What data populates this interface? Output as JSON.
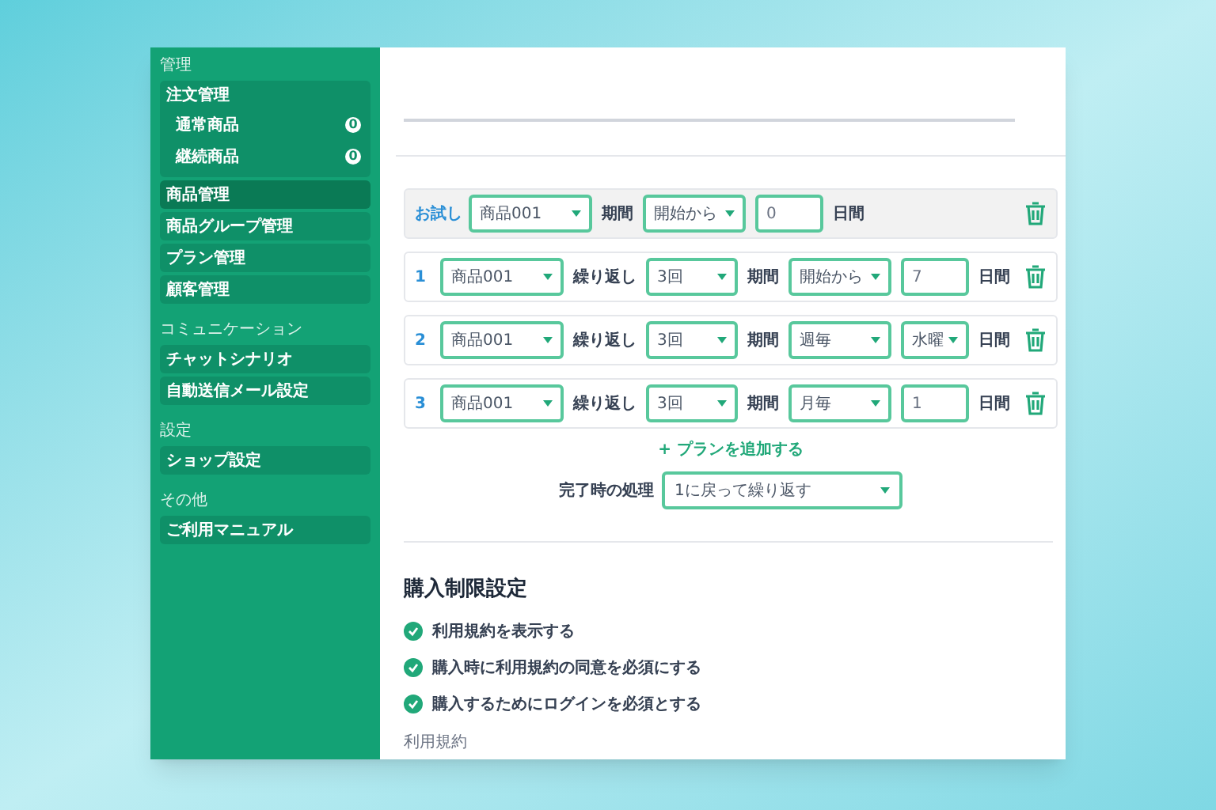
{
  "sidebar": {
    "sections": [
      {
        "heading": "管理",
        "items": [
          {
            "label": "注文管理",
            "selected": false,
            "children": [
              {
                "label": "通常商品",
                "badge": "0"
              },
              {
                "label": "継続商品",
                "badge": "0"
              }
            ]
          },
          {
            "label": "商品管理",
            "selected": true
          },
          {
            "label": "商品グループ管理",
            "selected": false
          },
          {
            "label": "プラン管理",
            "selected": false
          },
          {
            "label": "顧客管理",
            "selected": false
          }
        ]
      },
      {
        "heading": "コミュニケーション",
        "items": [
          {
            "label": "チャットシナリオ",
            "selected": false
          },
          {
            "label": "自動送信メール設定",
            "selected": false
          }
        ]
      },
      {
        "heading": "設定",
        "items": [
          {
            "label": "ショップ設定",
            "selected": false
          }
        ]
      },
      {
        "heading": "その他",
        "items": [
          {
            "label": "ご利用マニュアル",
            "selected": false
          }
        ]
      }
    ]
  },
  "plans": [
    {
      "kind": "trial",
      "index": "お試し",
      "product": "商品001",
      "period_label": "期間",
      "period": "開始から",
      "value": {
        "kind": "input",
        "text": "0"
      },
      "unit": "日間"
    },
    {
      "kind": "step",
      "index": "1",
      "product": "商品001",
      "repeat_label": "繰り返し",
      "repeat": "3回",
      "period_label": "期間",
      "period": "開始から",
      "value": {
        "kind": "input",
        "text": "7"
      },
      "unit": "日間"
    },
    {
      "kind": "step",
      "index": "2",
      "product": "商品001",
      "repeat_label": "繰り返し",
      "repeat": "3回",
      "period_label": "期間",
      "period": "週毎",
      "value": {
        "kind": "select",
        "text": "水曜"
      },
      "unit": "日間"
    },
    {
      "kind": "step",
      "index": "3",
      "product": "商品001",
      "repeat_label": "繰り返し",
      "repeat": "3回",
      "period_label": "期間",
      "period": "月毎",
      "value": {
        "kind": "input",
        "text": "1"
      },
      "unit": "日間"
    }
  ],
  "add_plan": "+ プランを追加する",
  "completion": {
    "label": "完了時の処理",
    "value": "1に戻って繰り返す"
  },
  "restrictions": {
    "title": "購入制限設定",
    "options": [
      {
        "label": "利用規約を表示する",
        "checked": true
      },
      {
        "label": "購入時に利用規約の同意を必須にする",
        "checked": true
      },
      {
        "label": "購入するためにログインを必須とする",
        "checked": true
      }
    ],
    "terms_label": "利用規約"
  }
}
